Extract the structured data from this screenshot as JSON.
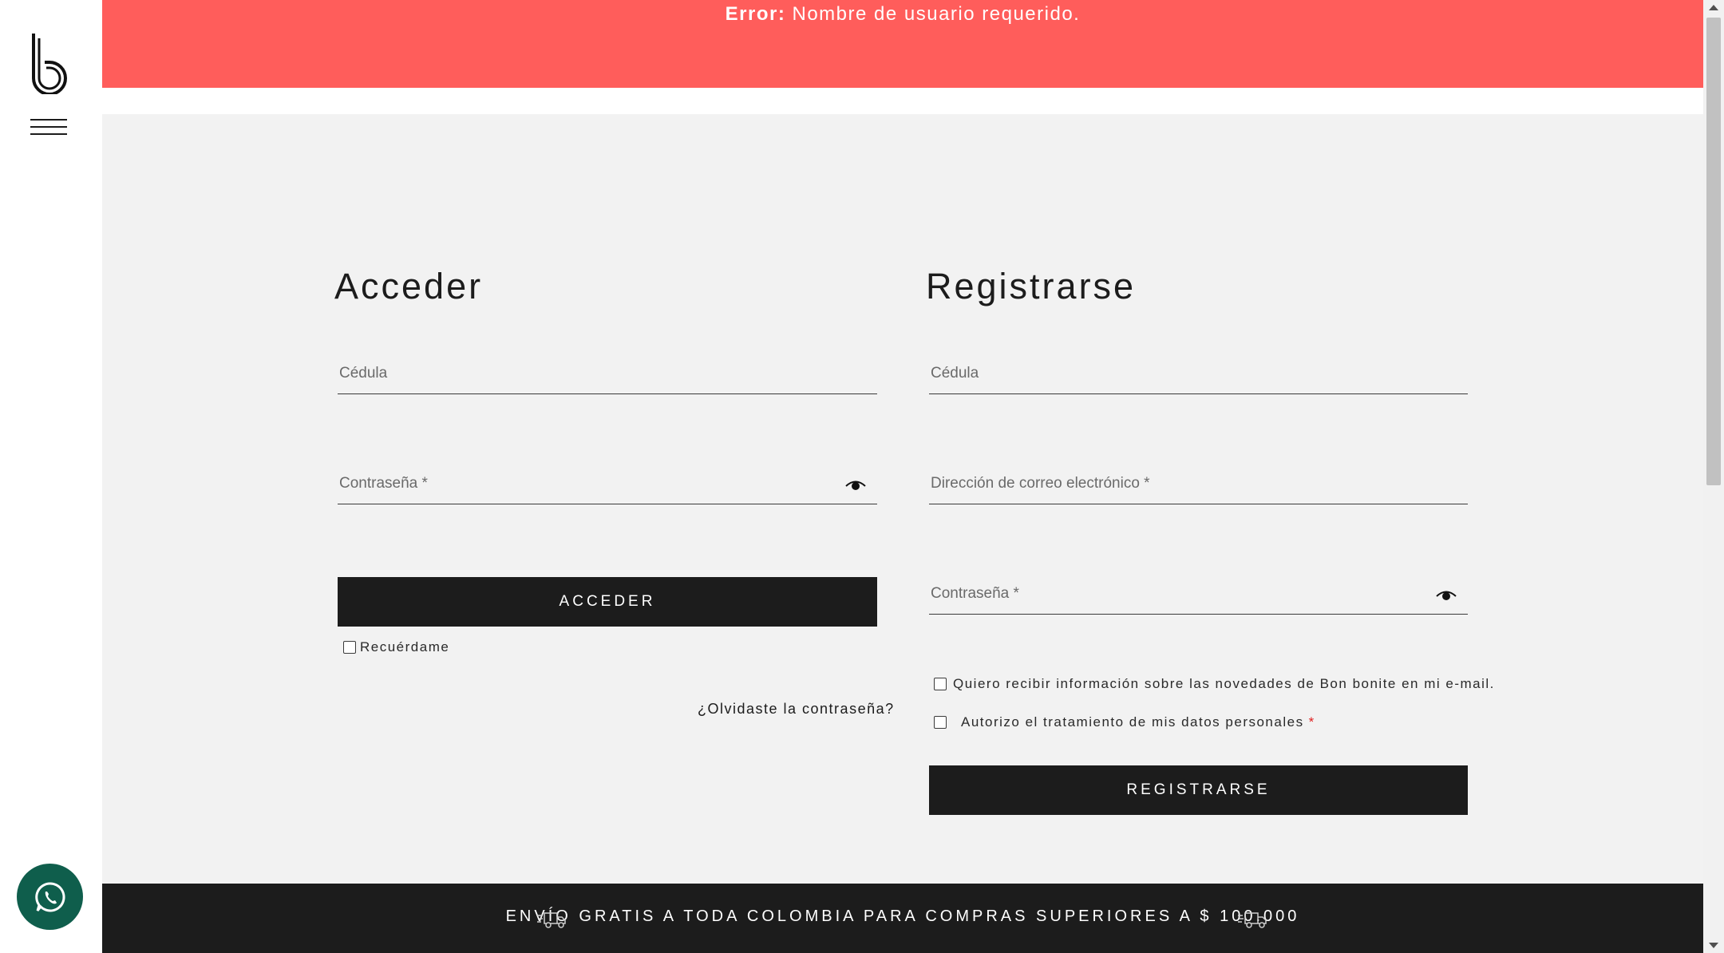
{
  "error": {
    "label": "Error:",
    "message": "Nombre de usuario requerido."
  },
  "login": {
    "title": "Acceder",
    "cedula_placeholder": "Cédula",
    "password_placeholder": "Contraseña *",
    "submit_label": "ACCEDER",
    "remember_label": "Recuérdame",
    "forgot_label": "¿Olvidaste la contraseña?"
  },
  "register": {
    "title": "Registrarse",
    "cedula_placeholder": "Cédula",
    "email_placeholder": "Dirección de correo electrónico *",
    "password_placeholder": "Contraseña *",
    "newsletter_label": "Quiero recibir información sobre las novedades de Bon bonite en mi e-mail.",
    "consent_label": "Autorizo el tratamiento de mis datos personales",
    "consent_required_mark": "*",
    "submit_label": "REGISTRARSE"
  },
  "shipping_banner": {
    "text": "ENVÍO GRATIS A TODA COLOMBIA PARA COMPRAS SUPERIORES A $ 100.000"
  },
  "icons": {
    "logo": "bon-bonite-logo",
    "menu": "hamburger-icon",
    "whatsapp": "whatsapp-icon",
    "eye": "eye-icon",
    "truck": "delivery-truck-icon"
  },
  "colors": {
    "error_bg": "#ff5d5b",
    "page_bg": "#f2f2f2",
    "button_bg": "#1c1c1c",
    "whatsapp_bg": "#0f5e4c",
    "required": "#e02020"
  }
}
